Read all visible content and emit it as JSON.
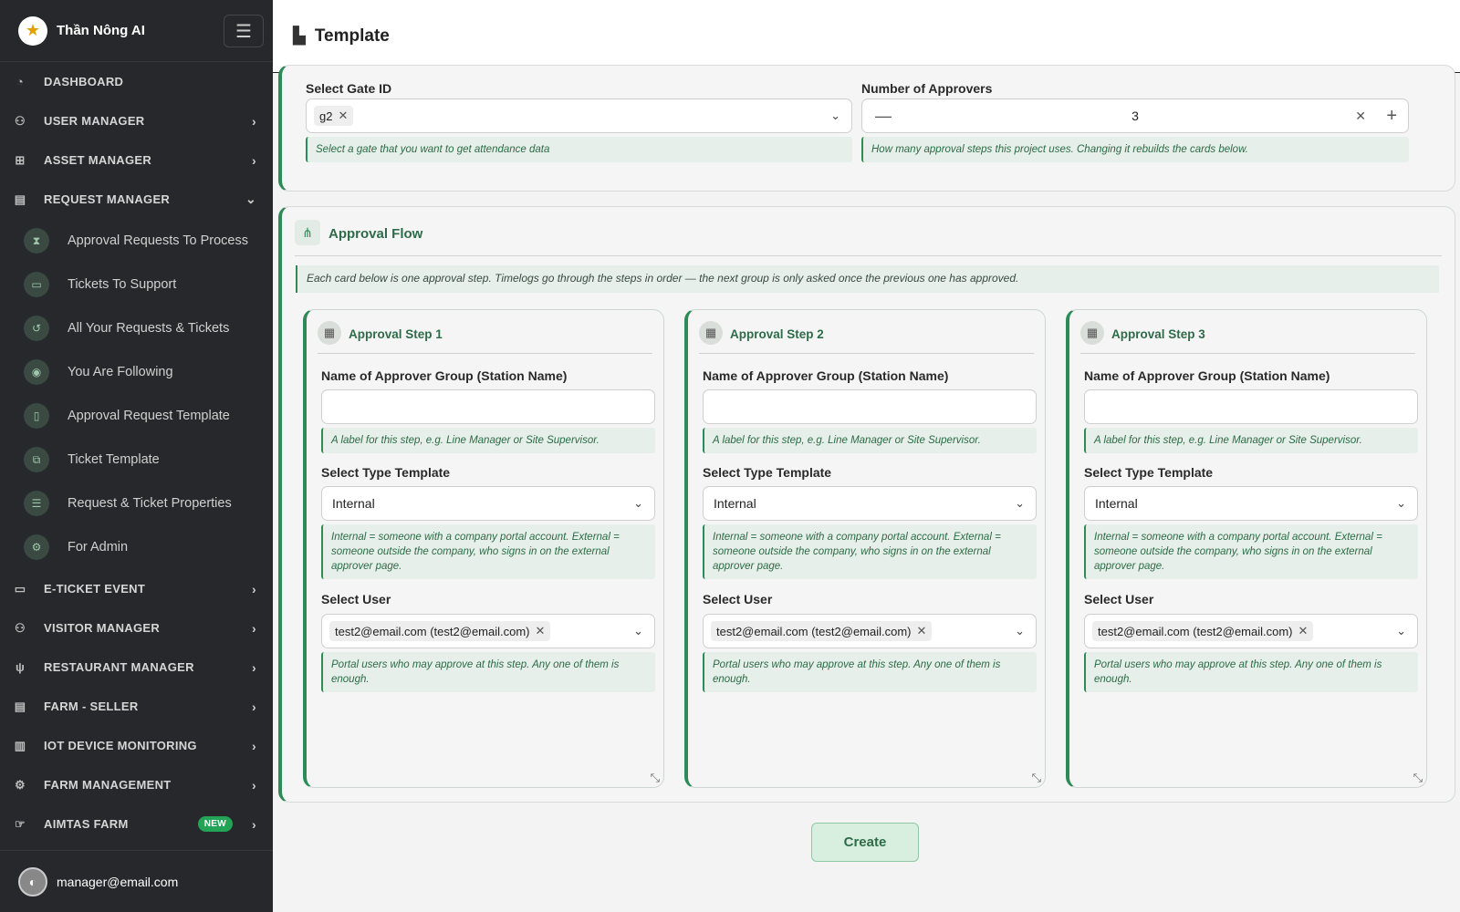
{
  "app": {
    "name": "Thần Nông AI"
  },
  "header": {
    "title": "Template"
  },
  "nav": {
    "dashboard": "DASHBOARD",
    "user_manager": "USER MANAGER",
    "asset_manager": "ASSET MANAGER",
    "request_manager": "REQUEST MANAGER",
    "sub_items": [
      "Approval Requests To Process",
      "Tickets To Support",
      "All Your Requests & Tickets",
      "You Are Following",
      "Approval Request Template",
      "Ticket Template",
      "Request & Ticket Properties",
      "For Admin"
    ],
    "eticket_event": "E-TICKET EVENT",
    "visitor_manager": "VISITOR MANAGER",
    "restaurant_manager": "RESTAURANT MANAGER",
    "farm_seller": "FARM - SELLER",
    "iot_device_monitoring": "IOT DEVICE MONITORING",
    "farm_management": "FARM MANAGEMENT",
    "aimtas_farm": "AIMTAS FARM",
    "new_badge": "NEW"
  },
  "user": {
    "email": "manager@email.com"
  },
  "form": {
    "gate_label": "Select Gate ID",
    "gate_value": "g2",
    "gate_hint": "Select a gate that you want to get attendance data",
    "approvers_label": "Number of Approvers",
    "approvers_value": "3",
    "approvers_hint": "How many approval steps this project uses. Changing it rebuilds the cards below."
  },
  "flow": {
    "title": "Approval Flow",
    "description": "Each card below is one approval step. Timelogs go through the steps in order — the next group is only asked once the previous one has approved.",
    "steps": [
      {
        "title": "Approval Step 1",
        "group_label": "Name of Approver Group (Station Name)",
        "group_value": "",
        "group_hint": "A label for this step, e.g. Line Manager or Site Supervisor.",
        "type_label": "Select Type Template",
        "type_value": "Internal",
        "type_hint": "Internal = someone with a company portal account. External = someone outside the company, who signs in on the external approver page.",
        "user_label": "Select User",
        "user_value": "test2@email.com (test2@email.com)",
        "user_hint": "Portal users who may approve at this step. Any one of them is enough."
      },
      {
        "title": "Approval Step 2",
        "group_label": "Name of Approver Group (Station Name)",
        "group_value": "",
        "group_hint": "A label for this step, e.g. Line Manager or Site Supervisor.",
        "type_label": "Select Type Template",
        "type_value": "Internal",
        "type_hint": "Internal = someone with a company portal account. External = someone outside the company, who signs in on the external approver page.",
        "user_label": "Select User",
        "user_value": "test2@email.com (test2@email.com)",
        "user_hint": "Portal users who may approve at this step. Any one of them is enough."
      },
      {
        "title": "Approval Step 3",
        "group_label": "Name of Approver Group (Station Name)",
        "group_value": "",
        "group_hint": "A label for this step, e.g. Line Manager or Site Supervisor.",
        "type_label": "Select Type Template",
        "type_value": "Internal",
        "type_hint": "Internal = someone with a company portal account. External = someone outside the company, who signs in on the external approver page.",
        "user_label": "Select User",
        "user_value": "test2@email.com (test2@email.com)",
        "user_hint": "Portal users who may approve at this step. Any one of them is enough."
      }
    ]
  },
  "actions": {
    "create_label": "Create"
  },
  "colors": {
    "accent": "#2e8b57",
    "sidebar_bg": "#26282b",
    "badge_new": "#22a355"
  }
}
